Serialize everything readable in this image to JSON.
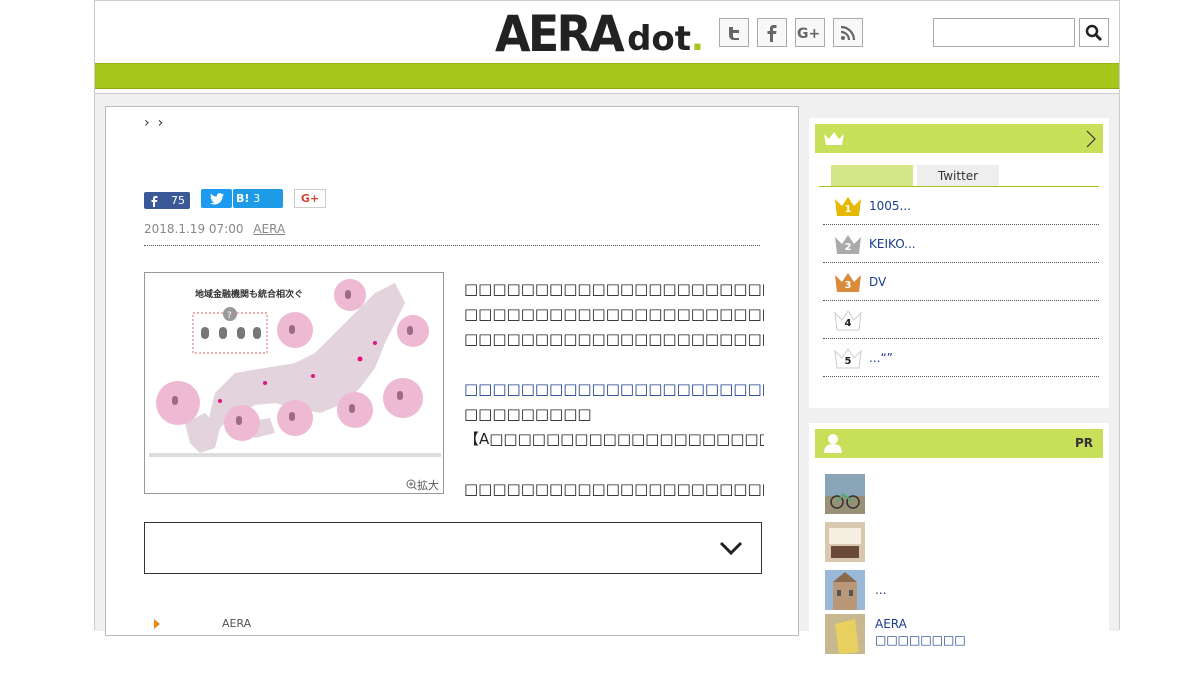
{
  "header": {
    "logo_main": "AERA",
    "logo_sub": "dot",
    "logo_period": ".",
    "social_icons": [
      "twitter-icon",
      "facebook-icon",
      "google-plus-icon",
      "rss-icon"
    ],
    "search_placeholder": "",
    "brand_color": "#a8c51c"
  },
  "article": {
    "breadcrumb_sep": "›",
    "share": {
      "facebook_count": "75",
      "hatena_label": "B!",
      "hatena_count": "3",
      "google_label": "G+"
    },
    "date": "2018.1.19 07:00",
    "source": "AERA",
    "figure": {
      "title": "地域金融機関も統合相次ぐ",
      "enlarge_label": "拡大"
    },
    "body_lines": [
      "□□□□□□□□□□□□□□□□□□□□□□□□□□□□□□□□□□□□□□□□",
      "□□□□□□□□□□□□□□□□□□□□□□□□□□□□□□□□□□□□□□□□",
      "□□□□□□□□□□□□□□□□□□□□□□□□□□□□□",
      "",
      "□□□□□□□□□□□□□□□□□□□□□□□□□□□□□",
      "□□□□□□□□□",
      "【A□□□□□□□□□□□□□□□□□□□□□□□□□□□□□□□□□□□□",
      "",
      "□□□□□□□□□□□□□□□□□□□□□□□□□□□□□□□□□□□□□□□□"
    ],
    "related_label": "AERA"
  },
  "ranking": {
    "tabs": [
      "",
      "Twitter"
    ],
    "items": [
      {
        "rank": "1",
        "title": "1005...",
        "color": "#e6b800"
      },
      {
        "rank": "2",
        "title": "KEIKO...",
        "color": "#aaaaaa"
      },
      {
        "rank": "3",
        "title": "DV",
        "color": "#d98a3a"
      },
      {
        "rank": "4",
        "title": "",
        "color": "#ffffff"
      },
      {
        "rank": "5",
        "title": "...“”",
        "color": "#ffffff"
      }
    ]
  },
  "pr": {
    "label": "PR",
    "items": [
      {
        "title": ""
      },
      {
        "title": ""
      },
      {
        "title": "..."
      },
      {
        "title": "AERA",
        "subtitle": "□□□□□□□□"
      }
    ]
  }
}
